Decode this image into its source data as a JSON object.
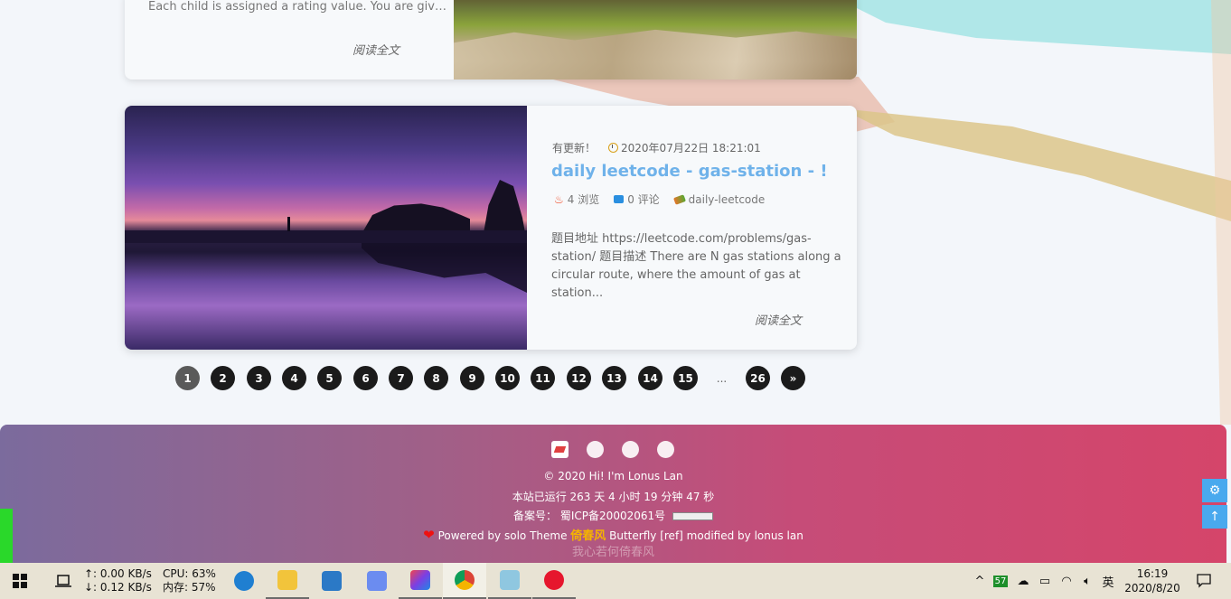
{
  "card1": {
    "excerpt": "Each child is assigned a rating value. You are givi...",
    "read_more": "阅读全文"
  },
  "card2": {
    "updated_badge": "有更新！",
    "date": "2020年07月22日 18:21:01",
    "title": "daily leetcode - gas-station - !",
    "views": "4 浏览",
    "comments": "0 评论",
    "tag": "daily-leetcode",
    "excerpt": "题目地址 https://leetcode.com/problems/gas-station/ 题目描述 There are N gas stations along a circular route, where the amount of gas at station...",
    "read_more": "阅读全文"
  },
  "pagination": {
    "pages": [
      "1",
      "2",
      "3",
      "4",
      "5",
      "6",
      "7",
      "8",
      "9",
      "10",
      "11",
      "12",
      "13",
      "14",
      "15",
      "...",
      "26",
      "»"
    ],
    "active": "1"
  },
  "footer": {
    "copyright_prefix": "© 2020",
    "site_name": "Hi! I'm Lonus Lan",
    "uptime": "本站已运行 263 天 4 小时 19 分钟 47 秒",
    "icp_label": "备案号：",
    "icp_number": "蜀ICP备20002061号",
    "powered_prefix": "Powered by",
    "solo": "solo",
    "theme_prefix": "Theme",
    "theme_name": "Butterfly",
    "ref": "[ref]",
    "modified_by": "modified by",
    "author": "lonus lan",
    "watermark": "倚春风",
    "faded_line": "我心若何倚春风"
  },
  "taskbar": {
    "net_up": "↑: 0.00 KB/s",
    "net_down": "↓: 0.12 KB/s",
    "cpu": "CPU: 63%",
    "mem": "内存: 57%",
    "tray_badge": "57",
    "ime": "英",
    "time": "16:19",
    "date": "2020/8/20"
  },
  "icons": {
    "side_top": "gear-icon",
    "side_bottom": "arrow-up-icon"
  }
}
